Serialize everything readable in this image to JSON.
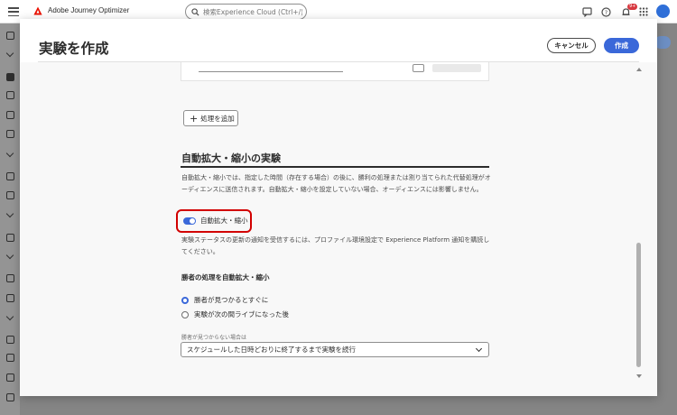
{
  "app": {
    "name": "Adobe Journey Optimizer",
    "brand_color": "#eb1000",
    "notifications_badge": "9+"
  },
  "search": {
    "placeholder": "検索Experience Cloud (Ctrl+/)"
  },
  "modal": {
    "title": "実験を作成",
    "cancel_label": "キャンセル",
    "create_label": "作成",
    "accent_color": "#3a68d9"
  },
  "content": {
    "add_treatment_label": "処理を追加",
    "section_title": "自動拡大・縮小の実験",
    "description": "自動拡大・縮小では、指定した時間（存在する場合）の後に、勝利の処理または割り当てられた代替処理がオーディエンスに送信されます。自動拡大・縮小を設定していない場合、オーディエンスには影響しません。",
    "toggle_label": "自動拡大・縮小",
    "toggle_on": true,
    "notification_note": "実験ステータスの更新の通知を受信するには、プロファイル環境設定で Experience Platform 通知を購読してください。",
    "winner_heading": "勝者の処理を自動拡大・縮小",
    "radio_options": [
      {
        "label": "勝者が見つかるとすぐに",
        "selected": true
      },
      {
        "label": "実験が次の間ライブになった後",
        "selected": false
      }
    ],
    "fallback_label": "勝者が見つからない場合は",
    "fallback_value": "スケジュールした日時どおりに終了するまで実験を続行"
  }
}
